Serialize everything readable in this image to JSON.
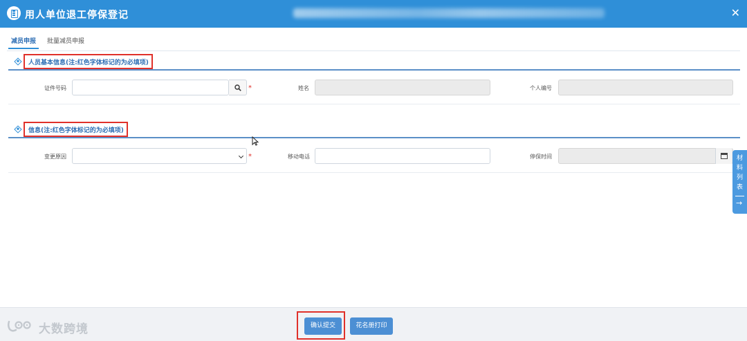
{
  "window": {
    "title": "用人单位退工停保登记",
    "close_glyph": "✕"
  },
  "tabs": [
    {
      "label": "减员申报",
      "active": true
    },
    {
      "label": "批量减员申报",
      "active": false
    }
  ],
  "section_personal": {
    "title": "人员基本信息(注:红色字体标记的为必填项)",
    "fields": {
      "id_number": {
        "label": "证件号码",
        "value": "",
        "placeholder": "",
        "required_mark": "*"
      },
      "name": {
        "label": "姓名",
        "value": ""
      },
      "personal_no": {
        "label": "个人编号",
        "value": ""
      }
    }
  },
  "section_info": {
    "title": "信息(注:红色字体标记的为必填项)",
    "fields": {
      "change_reason": {
        "label": "变更原因",
        "value": "",
        "required_mark": "*"
      },
      "mobile": {
        "label": "移动电话",
        "value": ""
      },
      "stop_time": {
        "label": "停保时间",
        "value": ""
      }
    }
  },
  "side_tab": {
    "label": "材料列表",
    "arrow": "→"
  },
  "footer": {
    "confirm_label": "确认提交",
    "print_label": "花名册打印"
  },
  "watermark": {
    "text": "大数跨境"
  },
  "colors": {
    "header_bg": "#2f8fd8",
    "accent": "#4c8fd4",
    "highlight_border": "#e0302a",
    "required": "#e0302a"
  }
}
